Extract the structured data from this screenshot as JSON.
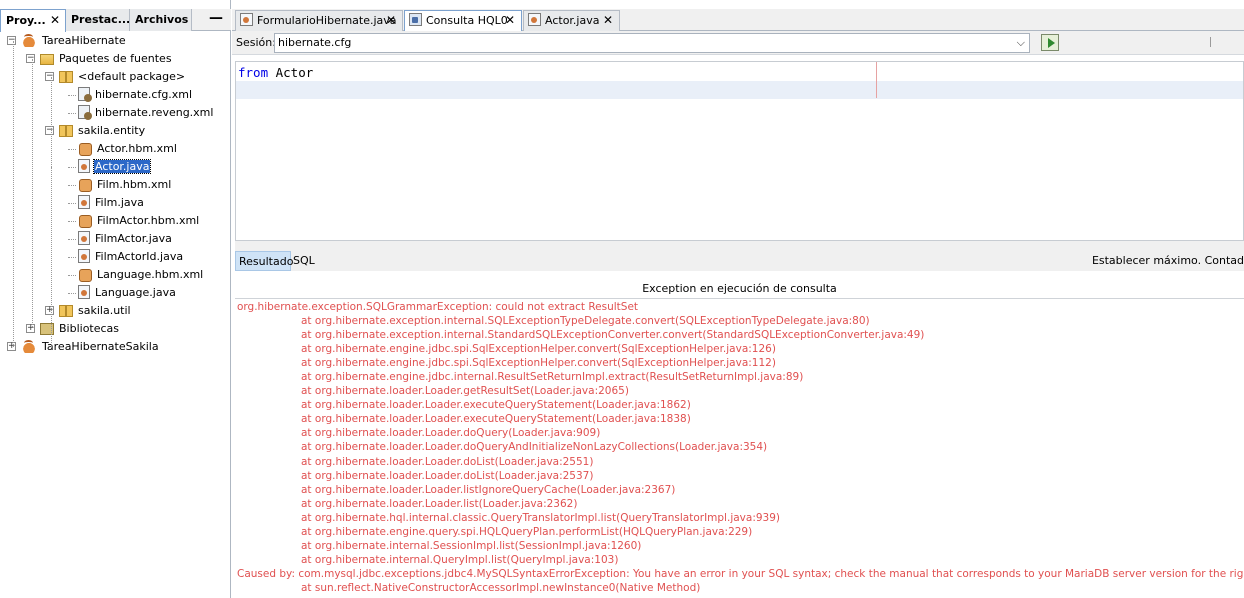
{
  "left_panel": {
    "tabs": [
      {
        "label": "Proy...",
        "close": "✕",
        "active": true
      },
      {
        "label": "Prestac...",
        "close": "",
        "active": false
      },
      {
        "label": "Archivos",
        "close": "",
        "active": false
      }
    ],
    "minimize": "—",
    "tree": [
      {
        "label": "TareaHibernate",
        "icon": "project-icon",
        "level": 0,
        "expanded": true
      },
      {
        "label": "Paquetes de fuentes",
        "icon": "source-packages-icon",
        "level": 1,
        "expanded": true
      },
      {
        "label": "<default package>",
        "icon": "package-icon",
        "level": 2,
        "expanded": true
      },
      {
        "label": "hibernate.cfg.xml",
        "icon": "cfg-file-icon",
        "level": 3
      },
      {
        "label": "hibernate.reveng.xml",
        "icon": "reveng-file-icon",
        "level": 3
      },
      {
        "label": "sakila.entity",
        "icon": "package-icon",
        "level": 2,
        "expanded": true
      },
      {
        "label": "Actor.hbm.xml",
        "icon": "hbm-file-icon",
        "level": 3
      },
      {
        "label": "Actor.java",
        "icon": "java-file-icon",
        "level": 3,
        "selected": true
      },
      {
        "label": "Film.hbm.xml",
        "icon": "hbm-file-icon",
        "level": 3
      },
      {
        "label": "Film.java",
        "icon": "java-file-icon",
        "level": 3
      },
      {
        "label": "FilmActor.hbm.xml",
        "icon": "hbm-file-icon",
        "level": 3
      },
      {
        "label": "FilmActor.java",
        "icon": "java-file-icon",
        "level": 3
      },
      {
        "label": "FilmActorId.java",
        "icon": "java-file-icon",
        "level": 3
      },
      {
        "label": "Language.hbm.xml",
        "icon": "hbm-file-icon",
        "level": 3
      },
      {
        "label": "Language.java",
        "icon": "java-file-icon",
        "level": 3
      },
      {
        "label": "sakila.util",
        "icon": "package-icon",
        "level": 2,
        "expanded": false
      },
      {
        "label": "Bibliotecas",
        "icon": "libraries-icon",
        "level": 1,
        "expanded": false
      },
      {
        "label": "TareaHibernateSakila",
        "icon": "project-icon",
        "level": 0,
        "expanded": false
      }
    ]
  },
  "editor": {
    "tabs": [
      {
        "label": "FormularioHibernate.java",
        "close": "✕",
        "icon": "java-file-icon",
        "active": false
      },
      {
        "label": "Consulta HQL0",
        "close": "✕",
        "icon": "hql-query-icon",
        "active": true
      },
      {
        "label": "Actor.java",
        "close": "✕",
        "icon": "java-file-icon",
        "active": false
      }
    ],
    "session_label": "Sesión:",
    "session_value": "hibernate.cfg",
    "query_keyword": "from",
    "query_rest": " Actor"
  },
  "results": {
    "tabs": [
      {
        "label": "Resultado",
        "active": true
      },
      {
        "label": "SQL",
        "active": false
      }
    ],
    "max_label": "Establecer máximo. Contad",
    "title": "Exception en ejecución de consulta",
    "trace": [
      {
        "text": "org.hibernate.exception.SQLGrammarException: could not extract ResultSet",
        "indent": false
      },
      {
        "text": "at org.hibernate.exception.internal.SQLExceptionTypeDelegate.convert(SQLExceptionTypeDelegate.java:80)",
        "indent": true
      },
      {
        "text": "at org.hibernate.exception.internal.StandardSQLExceptionConverter.convert(StandardSQLExceptionConverter.java:49)",
        "indent": true
      },
      {
        "text": "at org.hibernate.engine.jdbc.spi.SqlExceptionHelper.convert(SqlExceptionHelper.java:126)",
        "indent": true
      },
      {
        "text": "at org.hibernate.engine.jdbc.spi.SqlExceptionHelper.convert(SqlExceptionHelper.java:112)",
        "indent": true
      },
      {
        "text": "at org.hibernate.engine.jdbc.internal.ResultSetReturnImpl.extract(ResultSetReturnImpl.java:89)",
        "indent": true
      },
      {
        "text": "at org.hibernate.loader.Loader.getResultSet(Loader.java:2065)",
        "indent": true
      },
      {
        "text": "at org.hibernate.loader.Loader.executeQueryStatement(Loader.java:1862)",
        "indent": true
      },
      {
        "text": "at org.hibernate.loader.Loader.executeQueryStatement(Loader.java:1838)",
        "indent": true
      },
      {
        "text": "at org.hibernate.loader.Loader.doQuery(Loader.java:909)",
        "indent": true
      },
      {
        "text": "at org.hibernate.loader.Loader.doQueryAndInitializeNonLazyCollections(Loader.java:354)",
        "indent": true
      },
      {
        "text": "at org.hibernate.loader.Loader.doList(Loader.java:2551)",
        "indent": true
      },
      {
        "text": "at org.hibernate.loader.Loader.doList(Loader.java:2537)",
        "indent": true
      },
      {
        "text": "at org.hibernate.loader.Loader.listIgnoreQueryCache(Loader.java:2367)",
        "indent": true
      },
      {
        "text": "at org.hibernate.loader.Loader.list(Loader.java:2362)",
        "indent": true
      },
      {
        "text": "at org.hibernate.hql.internal.classic.QueryTranslatorImpl.list(QueryTranslatorImpl.java:939)",
        "indent": true
      },
      {
        "text": "at org.hibernate.engine.query.spi.HQLQueryPlan.performList(HQLQueryPlan.java:229)",
        "indent": true
      },
      {
        "text": "at org.hibernate.internal.SessionImpl.list(SessionImpl.java:1260)",
        "indent": true
      },
      {
        "text": "at org.hibernate.internal.QueryImpl.list(QueryImpl.java:103)",
        "indent": true
      },
      {
        "text": "Caused by: com.mysql.jdbc.exceptions.jdbc4.MySQLSyntaxErrorException: You have an error in your SQL syntax; check the manual that corresponds to your MariaDB server version for the right syntax to use",
        "indent": false
      },
      {
        "text": "at sun.reflect.NativeConstructorAccessorImpl.newInstance0(Native Method)",
        "indent": true
      }
    ]
  }
}
